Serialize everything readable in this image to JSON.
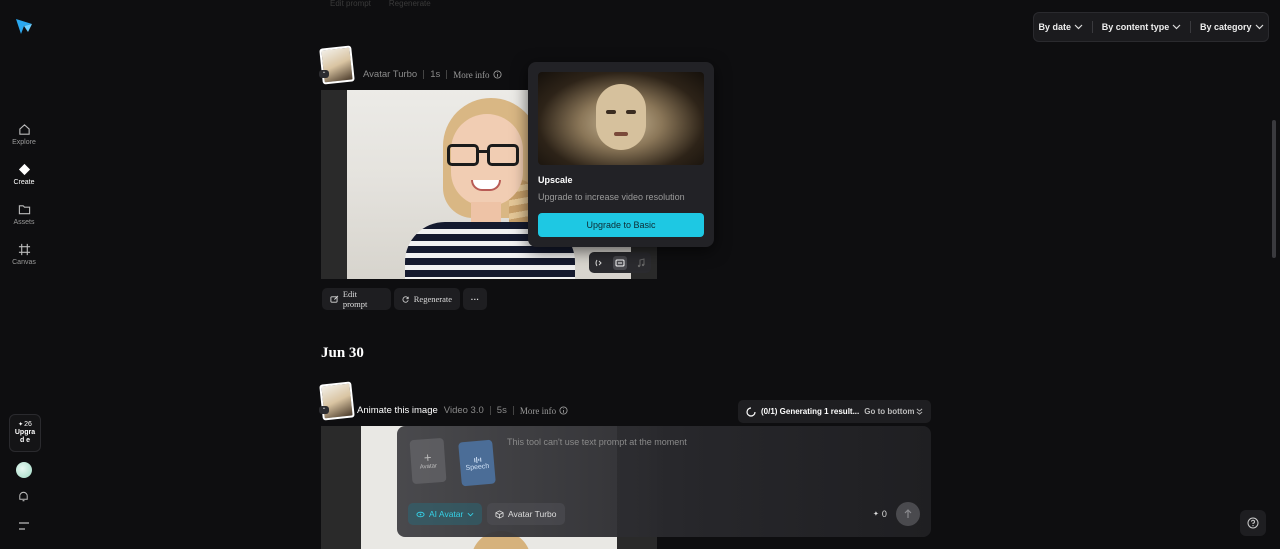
{
  "sidebar": {
    "items": [
      {
        "label": "Explore",
        "icon": "home-icon"
      },
      {
        "label": "Create",
        "icon": "diamond-icon"
      },
      {
        "label": "Assets",
        "icon": "folder-icon"
      },
      {
        "label": "Canvas",
        "icon": "canvas-icon"
      }
    ],
    "credits": "26",
    "upgrade_label": "Upgrad e"
  },
  "filters": {
    "by_date": "By date",
    "by_content_type": "By content type",
    "by_category": "By category"
  },
  "top_faded": {
    "edit_prompt": "Edit prompt",
    "regenerate": "Regenerate"
  },
  "card1": {
    "model": "Avatar Turbo",
    "duration": "1s",
    "more_info": "More info",
    "edit_prompt": "Edit prompt",
    "regenerate": "Regenerate",
    "more": "···"
  },
  "popover": {
    "title": "Upscale",
    "description": "Upgrade to increase video resolution",
    "button": "Upgrade to Basic"
  },
  "date_heading": "Jun 30",
  "card2": {
    "title": "Animate this image",
    "model": "Video 3.0",
    "duration": "5s",
    "more_info": "More info"
  },
  "generating": {
    "status": "(0/1) Generating 1 result...",
    "go_bottom": "Go to bottom"
  },
  "composer": {
    "placeholder": "This tool can't use text prompt at the moment",
    "avatar_card": "Avatar",
    "speech_card": "Speech",
    "mode_chip": "AI Avatar",
    "model_chip": "Avatar Turbo",
    "credits": "0"
  },
  "colors": {
    "accent": "#1ec8e3",
    "background": "#0e0e10"
  }
}
